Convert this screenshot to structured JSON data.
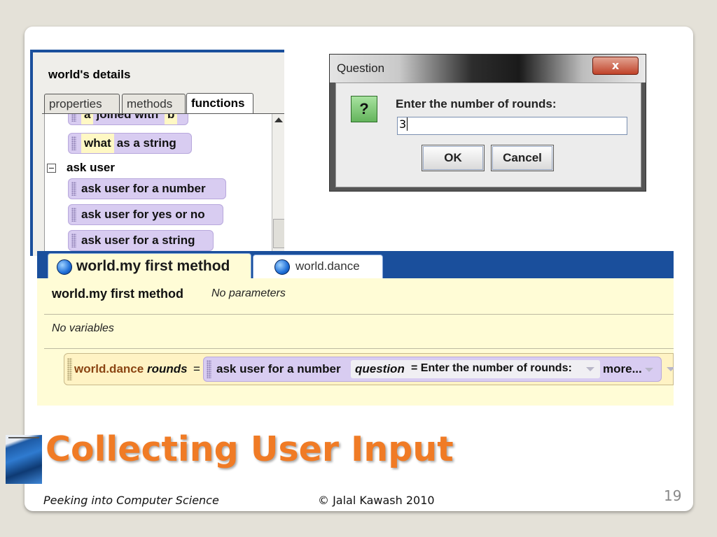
{
  "details_panel": {
    "title": "world's details",
    "tabs": [
      {
        "label": "properties"
      },
      {
        "label": "methods"
      },
      {
        "label": "functions"
      }
    ],
    "partial_tile": {
      "slot_a": "a",
      "text": "joined with",
      "slot_b": "b"
    },
    "string_tile": {
      "slot": "what",
      "text": "as a string"
    },
    "section_label": "ask user",
    "ask_tiles": [
      {
        "label": "ask user for a number"
      },
      {
        "label": "ask user for yes or no"
      },
      {
        "label": "ask user for a string"
      }
    ]
  },
  "question_dialog": {
    "title": "Question",
    "close_label": "x",
    "icon_label": "?",
    "prompt": "Enter the number of rounds:",
    "input_value": "3",
    "ok_label": "OK",
    "cancel_label": "Cancel"
  },
  "method_editor": {
    "tabs": [
      {
        "label": "world.my first method"
      },
      {
        "label": "world.dance"
      }
    ],
    "header_name": "world.my first method",
    "header_params": "No parameters",
    "no_variables": "No variables",
    "statement": {
      "call": "world.dance",
      "arg": "rounds",
      "equals": "=",
      "ask_label": "ask user for a number",
      "question_key": "question",
      "question_value": "= Enter the number of rounds:",
      "more_label": "more..."
    }
  },
  "slide": {
    "title": "Collecting User Input",
    "footer_left": "Peeking into Computer Science",
    "footer_mid": "© Jalal Kawash 2010",
    "page_number": "19"
  },
  "colors": {
    "title_orange": "#f07b25",
    "alice_blue": "#1a4f9c",
    "tile_purple": "#d8ccf1",
    "editor_yellow": "#fffcd6"
  }
}
